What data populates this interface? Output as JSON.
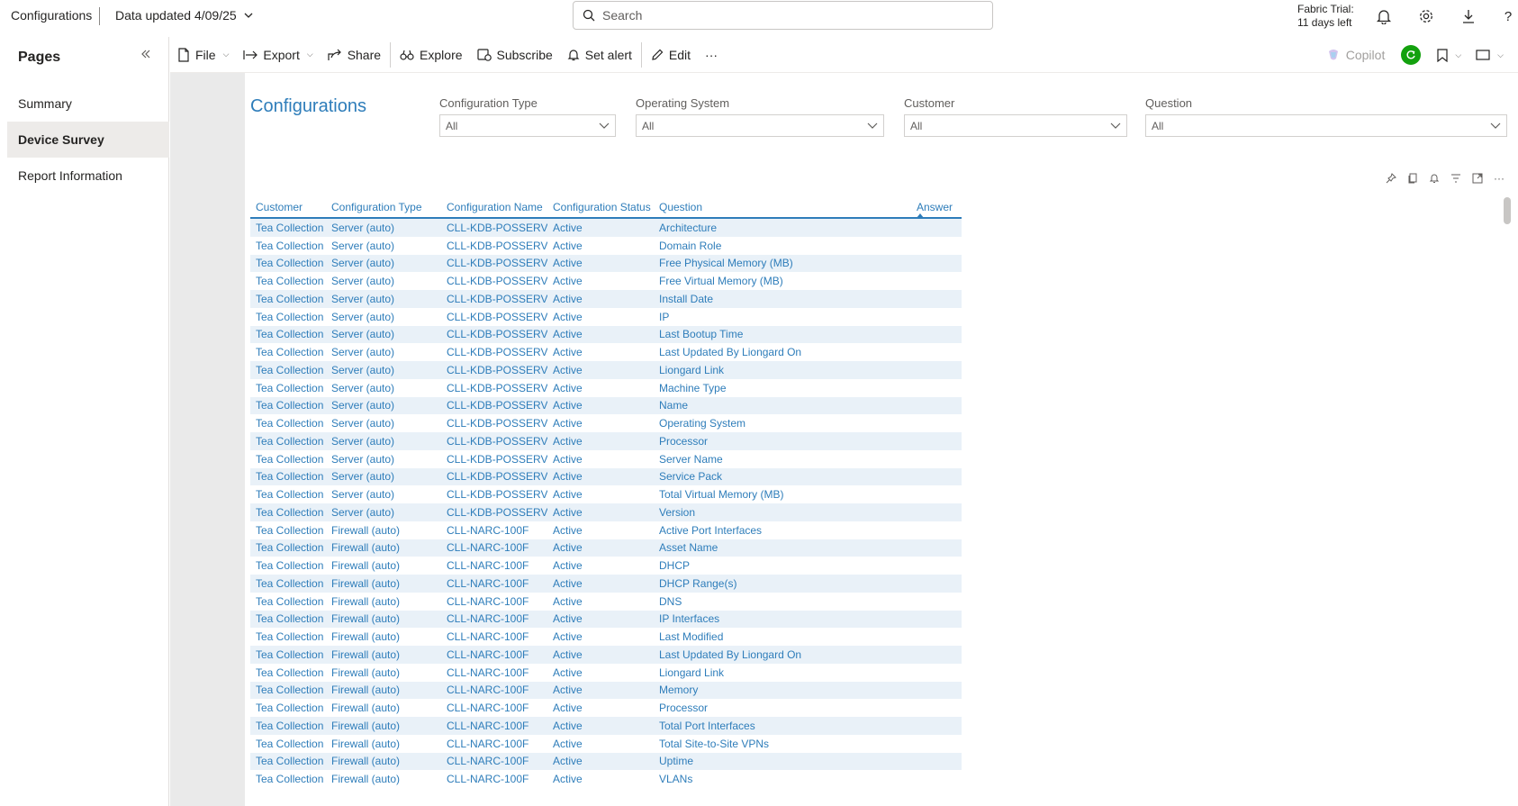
{
  "header": {
    "title": "Configurations",
    "data_updated": "Data updated 4/09/25",
    "search_placeholder": "Search",
    "trial_line1": "Fabric Trial:",
    "trial_line2": "11 days left",
    "help": "?"
  },
  "pages": {
    "title": "Pages",
    "items": [
      {
        "label": "Summary"
      },
      {
        "label": "Device Survey"
      },
      {
        "label": "Report Information"
      }
    ]
  },
  "toolbar": {
    "file": "File",
    "export": "Export",
    "share": "Share",
    "explore": "Explore",
    "subscribe": "Subscribe",
    "set_alert": "Set alert",
    "edit": "Edit",
    "more": "···",
    "copilot": "Copilot"
  },
  "report": {
    "title": "Configurations",
    "slicers": [
      {
        "label": "Configuration Type",
        "value": "All"
      },
      {
        "label": "Operating System",
        "value": "All"
      },
      {
        "label": "Customer",
        "value": "All"
      },
      {
        "label": "Question",
        "value": "All"
      }
    ],
    "table": {
      "columns": [
        "Customer",
        "Configuration Type",
        "Configuration Name",
        "Configuration Status",
        "Question",
        "Answer"
      ],
      "rows": [
        [
          "Tea Collection",
          "Server (auto)",
          "CLL-KDB-POSSERV",
          "Active",
          "Architecture",
          ""
        ],
        [
          "Tea Collection",
          "Server (auto)",
          "CLL-KDB-POSSERV",
          "Active",
          "Domain Role",
          ""
        ],
        [
          "Tea Collection",
          "Server (auto)",
          "CLL-KDB-POSSERV",
          "Active",
          "Free Physical Memory (MB)",
          ""
        ],
        [
          "Tea Collection",
          "Server (auto)",
          "CLL-KDB-POSSERV",
          "Active",
          "Free Virtual Memory (MB)",
          ""
        ],
        [
          "Tea Collection",
          "Server (auto)",
          "CLL-KDB-POSSERV",
          "Active",
          "Install Date",
          ""
        ],
        [
          "Tea Collection",
          "Server (auto)",
          "CLL-KDB-POSSERV",
          "Active",
          "IP",
          ""
        ],
        [
          "Tea Collection",
          "Server (auto)",
          "CLL-KDB-POSSERV",
          "Active",
          "Last Bootup Time",
          ""
        ],
        [
          "Tea Collection",
          "Server (auto)",
          "CLL-KDB-POSSERV",
          "Active",
          "Last Updated By Liongard On",
          ""
        ],
        [
          "Tea Collection",
          "Server (auto)",
          "CLL-KDB-POSSERV",
          "Active",
          "Liongard Link",
          ""
        ],
        [
          "Tea Collection",
          "Server (auto)",
          "CLL-KDB-POSSERV",
          "Active",
          "Machine Type",
          ""
        ],
        [
          "Tea Collection",
          "Server (auto)",
          "CLL-KDB-POSSERV",
          "Active",
          "Name",
          ""
        ],
        [
          "Tea Collection",
          "Server (auto)",
          "CLL-KDB-POSSERV",
          "Active",
          "Operating System",
          ""
        ],
        [
          "Tea Collection",
          "Server (auto)",
          "CLL-KDB-POSSERV",
          "Active",
          "Processor",
          ""
        ],
        [
          "Tea Collection",
          "Server (auto)",
          "CLL-KDB-POSSERV",
          "Active",
          "Server Name",
          ""
        ],
        [
          "Tea Collection",
          "Server (auto)",
          "CLL-KDB-POSSERV",
          "Active",
          "Service Pack",
          ""
        ],
        [
          "Tea Collection",
          "Server (auto)",
          "CLL-KDB-POSSERV",
          "Active",
          "Total Virtual Memory (MB)",
          ""
        ],
        [
          "Tea Collection",
          "Server (auto)",
          "CLL-KDB-POSSERV",
          "Active",
          "Version",
          ""
        ],
        [
          "Tea Collection",
          "Firewall (auto)",
          "CLL-NARC-100F",
          "Active",
          "Active Port Interfaces",
          ""
        ],
        [
          "Tea Collection",
          "Firewall (auto)",
          "CLL-NARC-100F",
          "Active",
          "Asset Name",
          ""
        ],
        [
          "Tea Collection",
          "Firewall (auto)",
          "CLL-NARC-100F",
          "Active",
          "DHCP",
          ""
        ],
        [
          "Tea Collection",
          "Firewall (auto)",
          "CLL-NARC-100F",
          "Active",
          "DHCP Range(s)",
          ""
        ],
        [
          "Tea Collection",
          "Firewall (auto)",
          "CLL-NARC-100F",
          "Active",
          "DNS",
          ""
        ],
        [
          "Tea Collection",
          "Firewall (auto)",
          "CLL-NARC-100F",
          "Active",
          "IP Interfaces",
          ""
        ],
        [
          "Tea Collection",
          "Firewall (auto)",
          "CLL-NARC-100F",
          "Active",
          "Last Modified",
          ""
        ],
        [
          "Tea Collection",
          "Firewall (auto)",
          "CLL-NARC-100F",
          "Active",
          "Last Updated By Liongard On",
          ""
        ],
        [
          "Tea Collection",
          "Firewall (auto)",
          "CLL-NARC-100F",
          "Active",
          "Liongard Link",
          ""
        ],
        [
          "Tea Collection",
          "Firewall (auto)",
          "CLL-NARC-100F",
          "Active",
          "Memory",
          ""
        ],
        [
          "Tea Collection",
          "Firewall (auto)",
          "CLL-NARC-100F",
          "Active",
          "Processor",
          ""
        ],
        [
          "Tea Collection",
          "Firewall (auto)",
          "CLL-NARC-100F",
          "Active",
          "Total Port Interfaces",
          ""
        ],
        [
          "Tea Collection",
          "Firewall (auto)",
          "CLL-NARC-100F",
          "Active",
          "Total Site-to-Site VPNs",
          ""
        ],
        [
          "Tea Collection",
          "Firewall (auto)",
          "CLL-NARC-100F",
          "Active",
          "Uptime",
          ""
        ],
        [
          "Tea Collection",
          "Firewall (auto)",
          "CLL-NARC-100F",
          "Active",
          "VLANs",
          ""
        ]
      ]
    }
  },
  "colors": {
    "accent": "#2e7dba",
    "row_alt": "#e9f1f8",
    "avatar": "#13a10e"
  },
  "icons": [
    "search-icon",
    "bell-icon",
    "gear-icon",
    "download-icon",
    "file-icon",
    "export-icon",
    "share-icon",
    "explore-icon",
    "subscribe-icon",
    "alert-icon",
    "edit-icon",
    "copilot-icon",
    "bookmark-icon",
    "view-icon",
    "pin-icon",
    "copy-icon",
    "filter-icon",
    "focus-icon"
  ]
}
